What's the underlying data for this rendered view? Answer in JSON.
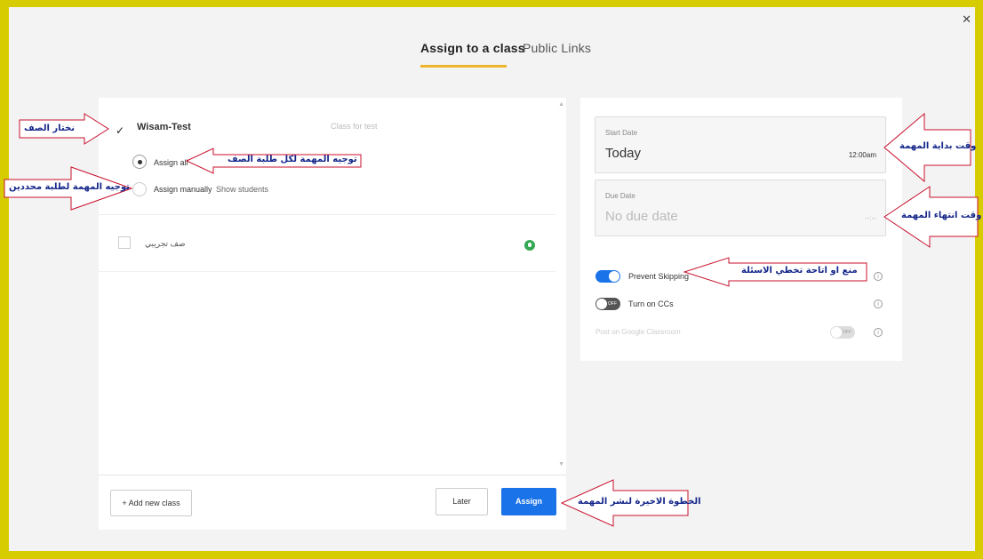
{
  "tabs": [
    {
      "label": "Assign to a class"
    },
    {
      "label": "Public Links"
    }
  ],
  "classes": [
    {
      "name": "Wisam-Test",
      "description": "Class for test",
      "checked": true,
      "options": {
        "assign_all": "Assign all",
        "assign_manually": "Assign manually",
        "show_students": "Show students"
      }
    },
    {
      "name": "صف تجريبي",
      "checked": false
    }
  ],
  "footer": {
    "add_class": "+ Add new class",
    "later": "Later",
    "assign": "Assign"
  },
  "schedule": {
    "start_label": "Start Date",
    "start_value": "Today",
    "start_time": "12:00am",
    "due_label": "Due Date",
    "due_value": "No due date",
    "due_time": "--:--"
  },
  "settings": [
    {
      "label": "Prevent Skipping",
      "on": true
    },
    {
      "label": "Turn on CCs",
      "on": false,
      "badge": "OFF"
    },
    {
      "label": "Post on Google Classroom",
      "on": false,
      "disabled": true,
      "badge": "OFF"
    }
  ],
  "annotations": {
    "choose_class": "نختار الصف",
    "assign_all_students": "توجيه المهمة لكل طلبة الصف",
    "assign_specific": "توجيه المهمة لطلبة محددين",
    "start_time": "وقت بداية المهمة",
    "end_time": "وقت انتهاء المهمة",
    "prevent_skip": "منع او اتاحة تخطي الاسئلة",
    "final_step": "الخطوة الاخيرة لنشر المهمة"
  },
  "colors": {
    "border": "#d7cc02",
    "accent": "#1a73e8",
    "tab_underline": "#f0b428",
    "annotation_text": "#14268a",
    "annotation_arrow": "#c8102e"
  }
}
